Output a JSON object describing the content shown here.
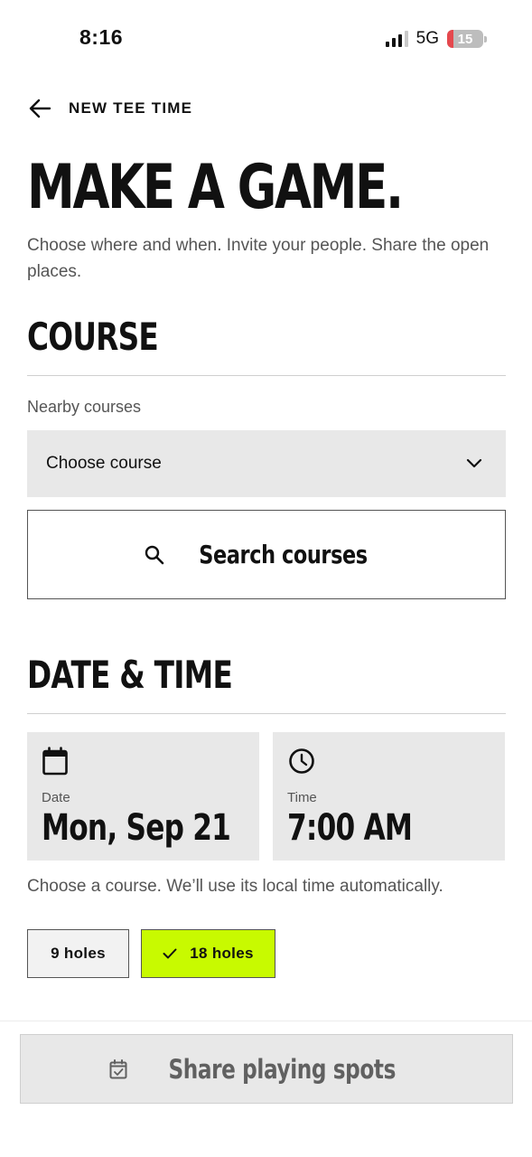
{
  "status_bar": {
    "time": "8:16",
    "network": "5G",
    "battery": "15"
  },
  "header": {
    "title": "NEW TEE TIME"
  },
  "page": {
    "title": "MAKE A GAME.",
    "subtitle": "Choose where and when. Invite your people. Share the open places."
  },
  "course": {
    "section_title": "COURSE",
    "nearby_label": "Nearby courses",
    "select_value": "Choose course",
    "search_label": "Search courses"
  },
  "datetime": {
    "section_title": "DATE & TIME",
    "date_label": "Date",
    "date_value": "Mon, Sep 21",
    "time_label": "Time",
    "time_value": "7:00 AM",
    "hint": "Choose a course. We’ll use its local time automatically."
  },
  "holes": {
    "options": [
      "9 holes",
      "18 holes"
    ],
    "selected": "18 holes"
  },
  "footer": {
    "share_label": "Share playing spots"
  },
  "colors": {
    "accent": "#c8fa00",
    "panel": "#e8e8e8",
    "text": "#111111",
    "muted": "#555555"
  },
  "icons": {
    "back": "arrow-left-icon",
    "dropdown": "chevron-down-icon",
    "search": "search-icon",
    "date": "calendar-icon",
    "time": "clock-icon",
    "selected": "check-icon",
    "share": "calendar-check-icon"
  }
}
